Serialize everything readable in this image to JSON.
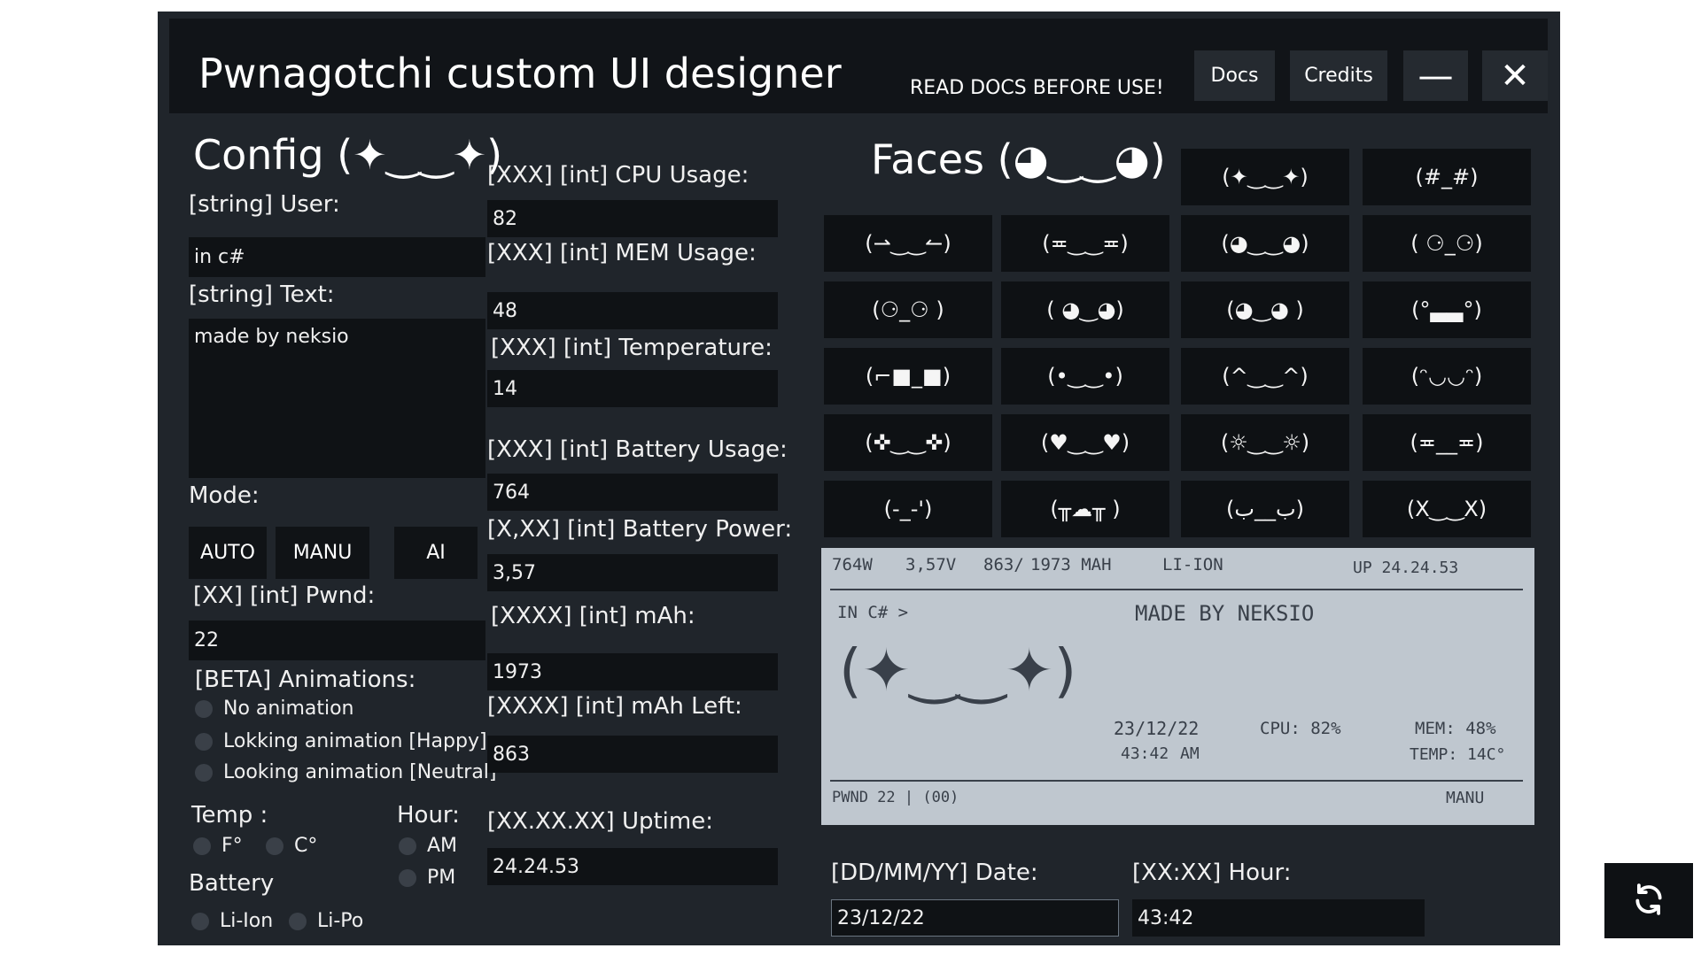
{
  "window": {
    "title": "Pwnagotchi custom UI designer",
    "notice": "READ DOCS BEFORE USE!",
    "buttons": {
      "docs": "Docs",
      "credits": "Credits",
      "minimize": "—",
      "close": "✕"
    }
  },
  "config": {
    "title": "Config (✦‿‿✦)",
    "user": {
      "label": "[string] User:",
      "value": "in c#"
    },
    "text": {
      "label": "[string] Text:",
      "value": "made by neksio"
    },
    "mode": {
      "label": "Mode:",
      "options": [
        "AUTO",
        "MANU",
        "AI"
      ]
    },
    "pwnd": {
      "label": "[XX] [int] Pwnd:",
      "value": "22"
    },
    "animations": {
      "label": "[BETA] Animations:",
      "options": [
        "No animation",
        "Lokking animation [Happy]",
        "Looking animation [Neutral]"
      ]
    },
    "temp": {
      "label": "Temp :",
      "options": [
        "F°",
        "C°"
      ]
    },
    "hour": {
      "label": "Hour:",
      "options": [
        "AM",
        "PM"
      ]
    },
    "battery": {
      "label": "Battery",
      "options": [
        "Li-Ion",
        "Li-Po"
      ]
    }
  },
  "stats": {
    "cpu": {
      "label": "[XXX] [int] CPU Usage:",
      "value": "82"
    },
    "mem": {
      "label": "[XXX] [int] MEM Usage:",
      "value": "48"
    },
    "temperature": {
      "label": "[XXX] [int] Temperature:",
      "value": "14"
    },
    "battery_usage": {
      "label": "[XXX] [int] Battery Usage:",
      "value": "764"
    },
    "battery_power": {
      "label": "[X,XX] [int] Battery Power:",
      "value": "3,57"
    },
    "mah": {
      "label": "[XXXX] [int] mAh:",
      "value": "1973"
    },
    "mah_left": {
      "label": "[XXXX] [int] mAh Left:",
      "value": "863"
    },
    "uptime": {
      "label": "[XX.XX.XX] Uptime:",
      "value": "24.24.53"
    }
  },
  "faces": {
    "title": "Faces (◕‿‿◕)",
    "rows": [
      [
        "(✦‿‿✦)",
        "(#_#)"
      ],
      [
        "(⇀‿‿↼)",
        "(≖‿‿≖)",
        "(◕‿‿◕)",
        "( ⚆_⚆)"
      ],
      [
        "(⚆_⚆ )",
        "( ◕‿◕)",
        "(◕‿◕ )",
        "(°▃▃°)"
      ],
      [
        "(⌐■_■)",
        "(•‿‿•)",
        "(^‿‿^)",
        "(ᵔ◡◡ᵔ)"
      ],
      [
        "(✜‿‿✜)",
        "(♥‿‿♥)",
        "(☼‿‿☼)",
        "(≖__≖)"
      ],
      [
        "(-_-')",
        "(╥☁╥ )",
        "(ب__ب)",
        "(X‿‿X)"
      ]
    ]
  },
  "preview": {
    "top": [
      "764W",
      "3,57V",
      "863/",
      "1973 MAH",
      "LI-ION"
    ],
    "uptime": "UP 24.24.53",
    "user": "IN C# >",
    "text": "MADE BY NEKSIO",
    "face": "(✦‿‿✦)",
    "date": "23/12/22",
    "time": "43:42",
    "ampm": "AM",
    "cpu": "CPU: 82%",
    "mem": "MEM: 48%",
    "temp": "TEMP: 14C°",
    "pwnd": "PWND 22 | (00)",
    "mode": "MANU"
  },
  "datetime": {
    "date": {
      "label": "[DD/MM/YY] Date:",
      "value": "23/12/22"
    },
    "hour": {
      "label": "[XX:XX] Hour:",
      "value": "43:42"
    }
  },
  "icons": {
    "refresh": "refresh-icon"
  }
}
